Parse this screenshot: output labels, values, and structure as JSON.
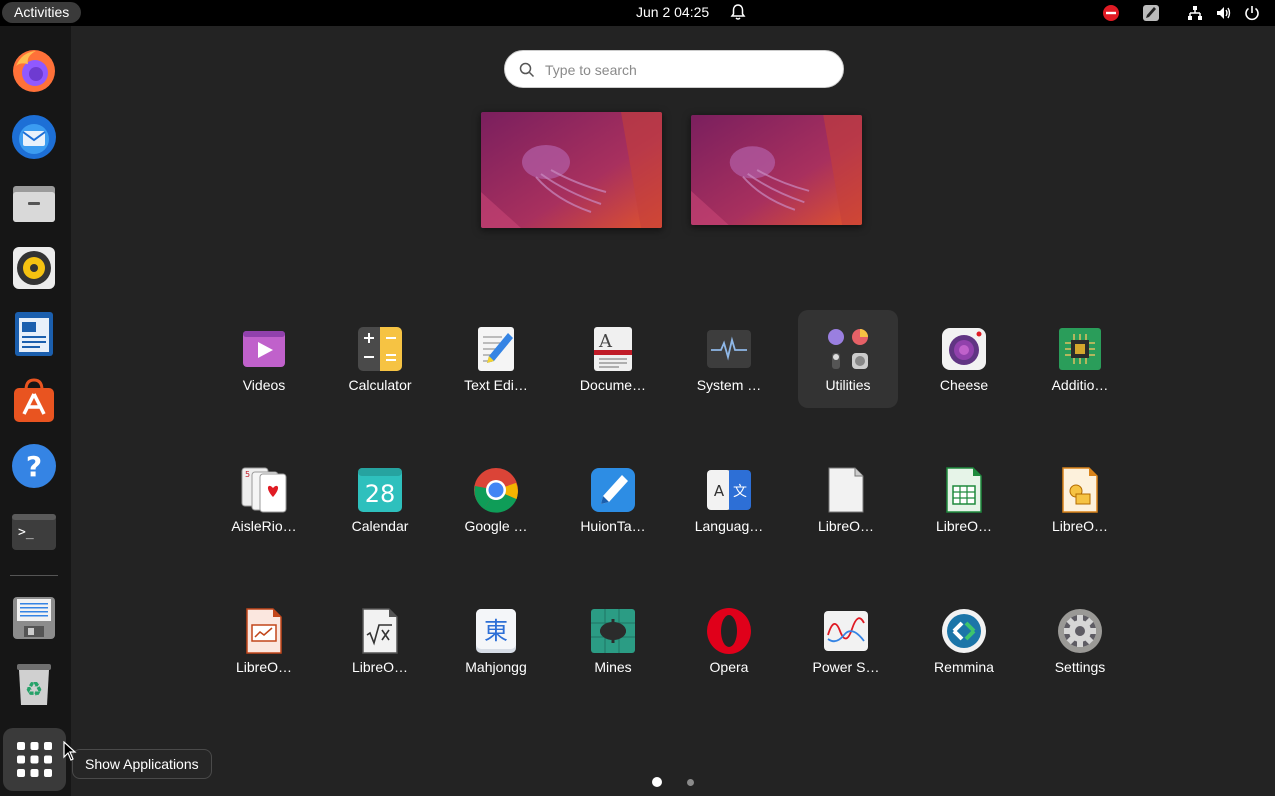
{
  "topbar": {
    "activities_label": "Activities",
    "clock": "Jun 2  04:25"
  },
  "search": {
    "placeholder": "Type to search"
  },
  "dock": {
    "items": [
      "Firefox",
      "Thunderbird",
      "Files",
      "Rhythmbox",
      "LibreOffice Writer",
      "Ubuntu Software",
      "Help",
      "Terminal",
      "Save",
      "Trash"
    ],
    "show_apps_tooltip": "Show Applications"
  },
  "apps": [
    {
      "label": "Videos",
      "icon": "videos-icon"
    },
    {
      "label": "Calculator",
      "icon": "calculator-icon"
    },
    {
      "label": "Text Edi…",
      "icon": "text-editor-icon"
    },
    {
      "label": "Docume…",
      "icon": "document-viewer-icon"
    },
    {
      "label": "System …",
      "icon": "system-monitor-icon"
    },
    {
      "label": "Utilities",
      "icon": "utilities-folder-icon"
    },
    {
      "label": "Cheese",
      "icon": "cheese-icon"
    },
    {
      "label": "Additio…",
      "icon": "additional-drivers-icon"
    },
    {
      "label": "AisleRio…",
      "icon": "aisleriot-icon"
    },
    {
      "label": "Calendar",
      "icon": "calendar-icon",
      "day": "28"
    },
    {
      "label": "Google …",
      "icon": "chrome-icon"
    },
    {
      "label": "HuionTa…",
      "icon": "huion-tablet-icon"
    },
    {
      "label": "Languag…",
      "icon": "language-support-icon"
    },
    {
      "label": "LibreO…",
      "icon": "libreoffice-icon"
    },
    {
      "label": "LibreO…",
      "icon": "libreoffice-calc-icon"
    },
    {
      "label": "LibreO…",
      "icon": "libreoffice-draw-icon"
    },
    {
      "label": "LibreO…",
      "icon": "libreoffice-impress-icon"
    },
    {
      "label": "LibreO…",
      "icon": "libreoffice-math-icon"
    },
    {
      "label": "Mahjongg",
      "icon": "mahjongg-icon",
      "glyph": "東"
    },
    {
      "label": "Mines",
      "icon": "mines-icon"
    },
    {
      "label": "Opera",
      "icon": "opera-icon"
    },
    {
      "label": "Power S…",
      "icon": "power-statistics-icon"
    },
    {
      "label": "Remmina",
      "icon": "remmina-icon"
    },
    {
      "label": "Settings",
      "icon": "settings-icon"
    }
  ],
  "pagination": {
    "pages": 2,
    "current": 1
  },
  "colors": {
    "accent": "#e95420",
    "background": "#232323",
    "dock": "#161616"
  }
}
